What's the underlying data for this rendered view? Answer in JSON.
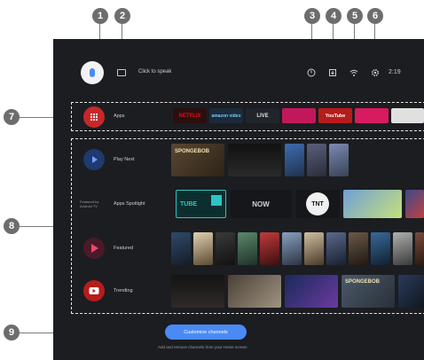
{
  "callouts": [
    "1",
    "2",
    "3",
    "4",
    "5",
    "6",
    "7",
    "8",
    "9"
  ],
  "header": {
    "speak_label": "Click to speak",
    "time": "2:19"
  },
  "rows": {
    "apps": {
      "label": "Apps"
    },
    "play_next": {
      "label": "Play Next"
    },
    "apps_spotlight": {
      "label": "Apps Spotlight",
      "sublabel": "Featured by Android TV"
    },
    "featured": {
      "label": "Featured"
    },
    "trending": {
      "label": "Trending"
    }
  },
  "app_tiles": [
    "NETFLIX",
    "amazon video",
    "LIVE",
    "",
    "YouTube",
    "",
    ""
  ],
  "spotlight_tiles": [
    "TUBE",
    "NOW",
    "TNT"
  ],
  "thumbs": {
    "spongebob_1": "SPONGEBOB",
    "spongebob_2": "SPONGEBOB"
  },
  "customize_button": "Customize channels",
  "customize_hint": "Add and remove channels from your Home screen",
  "colors": {
    "screen_bg": "#1b1d21",
    "accent": "#4a8af4",
    "callout": "#6d6d6d"
  }
}
